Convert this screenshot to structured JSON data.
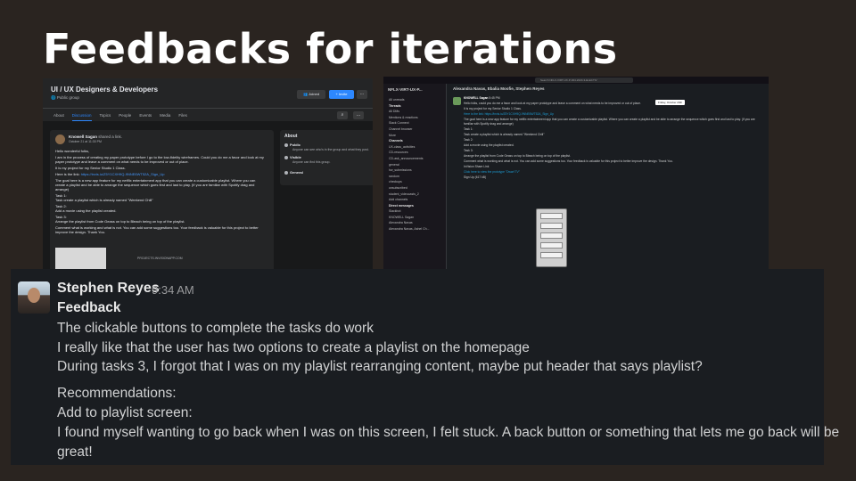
{
  "slide": {
    "title": "Feedbacks for iterations"
  },
  "facebook": {
    "group_name": "UI / UX Designers & Developers",
    "group_type": "Public group",
    "joined_label": "Joined",
    "invite_label": "+ Invite",
    "more_label": "...",
    "tabs": [
      "About",
      "Discussion",
      "Topics",
      "People",
      "Events",
      "Media",
      "Files"
    ],
    "active_tab": "Discussion",
    "post": {
      "author": "Knowell Sagan",
      "shared": "shared a link.",
      "date": "October 21 at 11:30 PM",
      "lines": [
        "Hello wonderful folks,",
        "I am in the process of creating my paper prototype before I go to the low-fidelity wireframes. Could you do me a favor and look at my paper prototype and leave a comment on what needs to be improved or out of place.",
        "It is my project for my Senior Studio 1 Class.",
        "The goal here is a new app feature for my netflix entertainment app that you can create a customizable playlist. Where you can create a playlist and be able to arrange the sequence which goes first and last to play. (If you are familiar with Spotify drag and arrange)",
        "Task 1:",
        "Task create a playlist which is already named \"Weekend Chill\"",
        "Task 2:",
        "Add a movie using the playlist created.",
        "Task 3:",
        "Arrange the playlist from Code Geass on top to Bleach being on top of the playlist.",
        "Comment what is working and what is not. You can add some suggestions too. Your feedback is valuable for this project to better improve the design. Thank You."
      ],
      "link_prefix": "Here is the link:",
      "link_text": "https://invis.io/Z5Y1CXH9Q-9NNE6WT52A_Sign_Up",
      "preview_label": "PROJECTS.INVISIONAPP.COM"
    },
    "about": {
      "title": "About",
      "public_title": "Public",
      "public_desc": "Anyone can see who's in the group and what they post.",
      "visible_title": "Visible",
      "visible_desc": "Anyone can find this group.",
      "general_title": "General"
    }
  },
  "slack_thumb": {
    "search": "Search NFLX-VIRT-UX-P-004-2020-3-ELECTIV",
    "workspace": "NFLX-VIRT-UX-P...",
    "sidebar": [
      "All unreads",
      "Threads",
      "All DMs",
      "Mentions & reactions",
      "Slack Connect",
      "Channel browser",
      "More",
      "Channels",
      "UX-class_activities",
      "CD-resources",
      "CD-ask_announcements",
      "general",
      "hw_submissions",
      "random",
      "checkups",
      "unsubscribed",
      "student_videocasts_2",
      "Add channels",
      "Direct messages",
      "Slackbot",
      "KNOWELL Sagan",
      "Alexandra Navas",
      "Alexandra Navas, Ashel Ch..."
    ],
    "bold_items": [
      "Threads",
      "Channels",
      "Direct messages"
    ],
    "channel_header": "Alexandra Navas, Ebalia Moofie, Stephen Reyes",
    "tooltip": "Friday, October 29th",
    "message": {
      "author": "KNOWELL Sagan",
      "time": "5:45 PM",
      "lines": [
        "Hello folks, could you do me a favor and look at my paper prototype and leave a comment on what needs to be improved or out of place.",
        "It is my project for my Senior Studio 1 Class.",
        "Here is the link: https://invis.io/Z5Y1CXH9Q-9NNE6WT52A_Sign_Up",
        "The goal here is a new app feature for my netflix entertainment app that you can create a customizable playlist. Where you can create a playlist and be able to arrange the sequence which goes first and last to play. (If you are familiar with Spotify drag and arrange)",
        "Task 1:",
        "Task create a playlist which is already named \"Weekend Chill\"",
        "Task 2:",
        "Add a movie using the playlist created.",
        "Task 3:",
        "Arrange the playlist from Code Geass on top to Bleach being on top of the playlist.",
        "Comment what is working and what is not. You can add some suggestions too. Your feedback is valuable for this project to better improve the design. Thank You.",
        "InVision Share Link",
        "Click here to view the prototype \"Dwarf TV\"",
        "Sign Up (617 kB)"
      ]
    }
  },
  "message": {
    "author": "Stephen Reyes",
    "time": "9:34 AM",
    "title": "Feedback",
    "lines": [
      "The clickable buttons to complete the tasks do work",
      "I really like that the user has two options to create a playlist on the homepage",
      "During tasks 3, I forgot that I was on my playlist rearranging content, maybe put header that says playlist?"
    ],
    "recommendations_title": "Recommendations:",
    "screen_title": "Add to playlist screen:",
    "rec_line_1": "I found myself wanting to go back when I was on this screen, I felt stuck. A back button or something that lets me go back will be",
    "rec_line_2": "great!"
  }
}
